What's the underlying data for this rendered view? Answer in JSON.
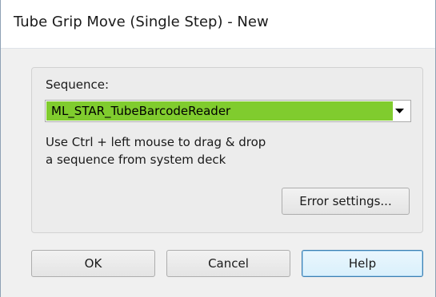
{
  "window": {
    "title": "Tube Grip Move (Single Step) - New"
  },
  "sequence": {
    "label": "Sequence:",
    "value": "ML_STAR_TubeBarcodeReader",
    "highlight_color": "#80cc2e"
  },
  "hint": {
    "line1": "Use Ctrl + left mouse to drag & drop",
    "line2": "a sequence from system deck"
  },
  "buttons": {
    "error_settings": "Error settings...",
    "ok": "OK",
    "cancel": "Cancel",
    "help": "Help"
  },
  "icons": {
    "dropdown": "chevron-down-icon"
  }
}
